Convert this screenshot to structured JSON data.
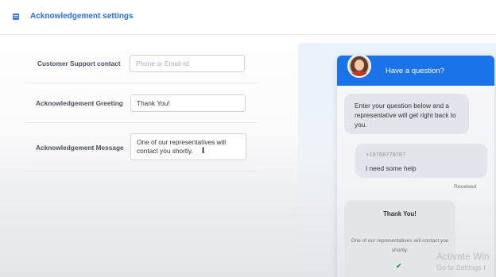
{
  "header": {
    "title": "Acknowledgement settings",
    "icon": "list-icon"
  },
  "form": {
    "support_contact": {
      "label": "Customer Support contact",
      "placeholder": "Phone or Email-Id",
      "value": ""
    },
    "greeting": {
      "label": "Acknowledgement Greeting",
      "value": "Thank You!"
    },
    "message": {
      "label": "Acknowledgement Message",
      "value": "One of our representatives will contact you shortly."
    }
  },
  "preview": {
    "title": "Have a question?",
    "intro_message": "Enter your question below and a representative will get right back to you.",
    "user_phone": "+19768778787",
    "user_message": "I need some help",
    "status": "Received",
    "ack_title": "Thank You!",
    "ack_message": "One of our representatives will contact you shortly."
  },
  "watermark": {
    "line1": "Activate Win",
    "line2": "Go to Settings t"
  },
  "colors": {
    "accent": "#1a73e8",
    "title": "#2a6fdb",
    "check": "#2e9e55"
  }
}
